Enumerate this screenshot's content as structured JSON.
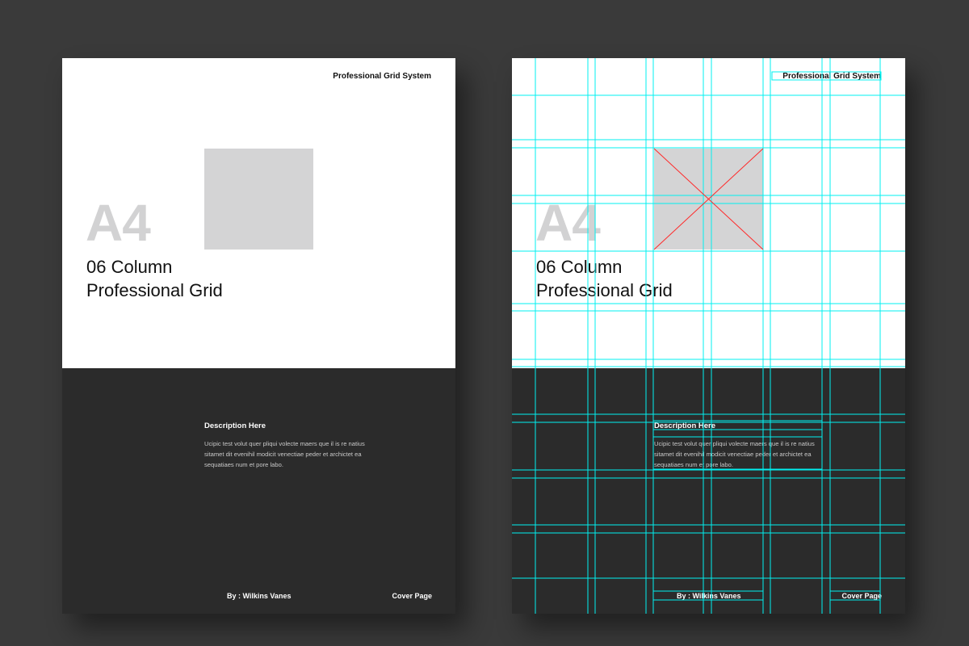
{
  "pages": [
    {
      "variant": "plain",
      "header": "Professional Grid System",
      "format_label": "A4",
      "title_line1": "06 Column",
      "title_line2": "Professional Grid",
      "description_heading": "Description Here",
      "description_body": "Ucipic test volut quer pliqui volecte maers que il is re natius sitamet dit evenihil modicit venectiae peder et archictet ea sequatiaes num et pore labo.",
      "byline": "By : Wilkins Vanes",
      "page_label": "Cover Page"
    },
    {
      "variant": "grid-overlay",
      "header": "Professional Grid System",
      "format_label": "A4",
      "title_line1": "06 Column",
      "title_line2": "Professional Grid",
      "description_heading": "Description Here",
      "description_body": "Ucipic test volut quer pliqui volecte maers que il is re natius sitamet dit evenihil modicit venectiae peder et archictet ea sequatiaes num et pore labo.",
      "byline": "By : Wilkins Vanes",
      "page_label": "Cover Page"
    }
  ],
  "colors": {
    "background": "#3a3a3a",
    "page_top": "#ffffff",
    "page_bottom": "#2b2b2b",
    "placeholder": "#d4d4d5",
    "grid_guide": "#00f0f0",
    "margin_guide": "#d24cff",
    "image_frame_cross": "#ff2a2a"
  }
}
